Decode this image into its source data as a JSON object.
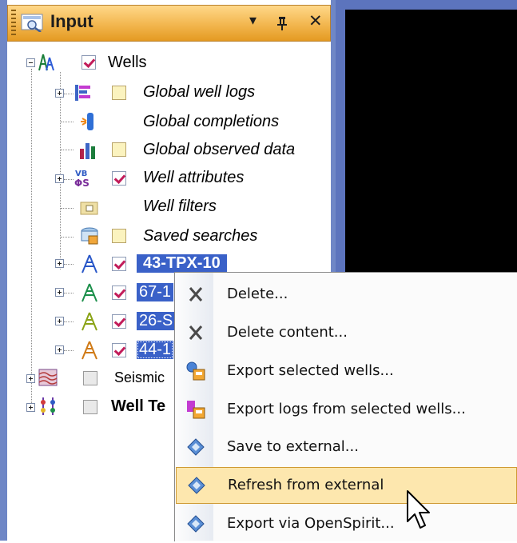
{
  "panel": {
    "title": "Input",
    "dropdown_glyph": "▾",
    "pin_glyph": "ᵖ",
    "close_glyph": "✕"
  },
  "tree": {
    "wells": {
      "label": "Wells",
      "checked": true,
      "icon": "wells-icon"
    },
    "children": [
      {
        "label": "Global well logs",
        "icon": "well-logs-icon",
        "checkbox": "empty",
        "expander": true
      },
      {
        "label": "Global completions",
        "icon": "completions-icon",
        "checkbox": "none",
        "expander": false
      },
      {
        "label": "Global observed data",
        "icon": "observed-data-icon",
        "checkbox": "empty",
        "expander": false
      },
      {
        "label": "Well attributes",
        "icon": "well-attributes-icon",
        "checkbox": "checked",
        "expander": true
      },
      {
        "label": "Well filters",
        "icon": "well-filters-icon",
        "checkbox": "none",
        "expander": false
      },
      {
        "label": "Saved searches",
        "icon": "saved-searches-icon",
        "checkbox": "empty",
        "expander": false
      },
      {
        "label": "43-TPX-10",
        "icon": "well-icon",
        "checkbox": "checked",
        "expander": true,
        "selected": true
      },
      {
        "label": "67-1",
        "icon": "well-icon",
        "checkbox": "checked",
        "expander": true,
        "selected": true
      },
      {
        "label": "26-S",
        "icon": "well-icon",
        "checkbox": "checked",
        "expander": true,
        "selected": true
      },
      {
        "label": "44-1",
        "icon": "well-icon",
        "checkbox": "checked",
        "expander": true,
        "selected": true
      }
    ],
    "seismic": {
      "label": "Seismic",
      "icon": "seismic-icon"
    },
    "well_tops": {
      "label": "Well Te",
      "icon": "well-tops-icon"
    }
  },
  "context_menu": {
    "items": [
      {
        "label": "Delete...",
        "icon": "delete-icon"
      },
      {
        "label": "Delete content...",
        "icon": "delete-content-icon"
      },
      {
        "label": "Export selected wells...",
        "icon": "export-wells-icon"
      },
      {
        "label": "Export logs from selected wells...",
        "icon": "export-logs-icon"
      },
      {
        "label": "Save to external...",
        "icon": "save-external-icon"
      },
      {
        "label": "Refresh from external",
        "icon": "refresh-external-icon",
        "hovered": true
      },
      {
        "label": "Export via OpenSpirit...",
        "icon": "openspirit-icon"
      }
    ]
  },
  "colors": {
    "title_bar": "#f2b64e",
    "selection": "#3a61c8",
    "menu_hover": "#fde7ae",
    "frame": "#6f87c6"
  }
}
